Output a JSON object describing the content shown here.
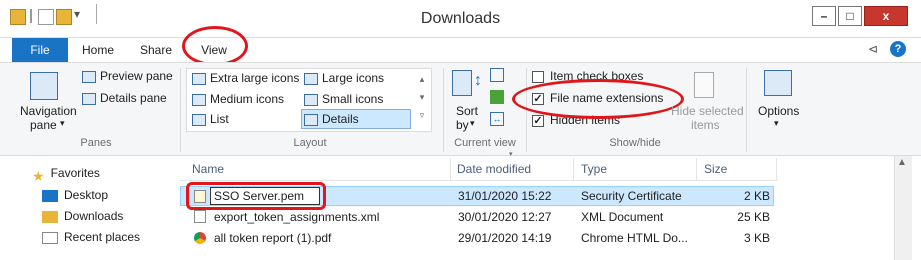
{
  "window": {
    "title": "Downloads",
    "controls": {
      "minimize": "–",
      "maximize": "□",
      "close": "x"
    }
  },
  "tabs": [
    "File",
    "Home",
    "Share",
    "View"
  ],
  "ribbon": {
    "panes": {
      "navigation_pane": "Navigation",
      "navigation_pane_2": "pane",
      "preview_pane": "Preview pane",
      "details_pane": "Details pane",
      "label": "Panes"
    },
    "layout": {
      "items": [
        "Extra large icons",
        "Large icons",
        "Medium icons",
        "Small icons",
        "List",
        "Details"
      ],
      "label": "Layout"
    },
    "current_view": {
      "sort_by_1": "Sort",
      "sort_by_2": "by",
      "label": "Current view"
    },
    "show_hide": {
      "item_check_boxes": "Item check boxes",
      "file_name_extensions": "File name extensions",
      "hidden_items": "Hidden items",
      "hide_selected_1": "Hide selected",
      "hide_selected_2": "items",
      "label": "Show/hide",
      "file_name_extensions_checked": true,
      "hidden_items_checked": true
    },
    "options": "Options"
  },
  "nav": {
    "items": [
      "Favorites",
      "Desktop",
      "Downloads",
      "Recent places"
    ]
  },
  "columns": {
    "name": "Name",
    "date": "Date modified",
    "type": "Type",
    "size": "Size"
  },
  "files": [
    {
      "name": "SSO Server.pem",
      "date": "31/01/2020 15:22",
      "type": "Security Certificate",
      "size": "2 KB"
    },
    {
      "name": "export_token_assignments.xml",
      "date": "30/01/2020 12:27",
      "type": "XML Document",
      "size": "25 KB"
    },
    {
      "name": "all token report (1).pdf",
      "date": "29/01/2020 14:19",
      "type": "Chrome HTML Do...",
      "size": "3 KB"
    }
  ],
  "colors": {
    "accent": "#1a74c6",
    "highlight": "#e0161b",
    "selected_row": "#cce8ff"
  }
}
